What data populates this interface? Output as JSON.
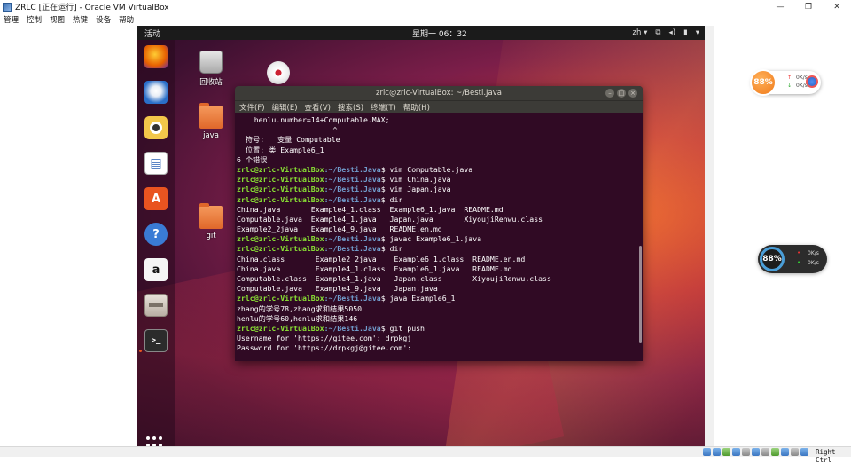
{
  "host": {
    "title": "ZRLC [正在运行] - Oracle VM VirtualBox",
    "menu": [
      "管理",
      "控制",
      "视图",
      "热键",
      "设备",
      "帮助"
    ],
    "controls": {
      "minimize": "—",
      "maximize": "❐",
      "close": "✕"
    },
    "host_key": "Right Ctrl"
  },
  "vm": {
    "top_panel": {
      "activities": "活动",
      "clock": "星期一 06：32",
      "lang": "zh ▾",
      "network_icon": "network-icon",
      "sound_icon": "sound-icon",
      "battery_icon": "battery-icon",
      "system_menu": "▾"
    },
    "desktop_icons": [
      {
        "label": "回收站",
        "icon": "trash-icon"
      },
      {
        "label": "java",
        "icon": "folder-icon"
      },
      {
        "label": "git",
        "icon": "folder-icon"
      },
      {
        "label": "",
        "icon": "cd-icon"
      }
    ],
    "dock": [
      {
        "name": "firefox",
        "glyph": "🦊",
        "color": "#e66000"
      },
      {
        "name": "thunderbird",
        "glyph": "✉",
        "color": "#2a6fc9"
      },
      {
        "name": "rhythmbox",
        "glyph": "◉",
        "color": "#f3c74a"
      },
      {
        "name": "libreoffice-writer",
        "glyph": "▤",
        "color": "#2a61b4"
      },
      {
        "name": "software-center",
        "glyph": "A",
        "color": "#e95420"
      },
      {
        "name": "help",
        "glyph": "?",
        "color": "#3a7bd5"
      },
      {
        "name": "amazon",
        "glyph": "a",
        "color": "#f5f5f5"
      },
      {
        "name": "files",
        "glyph": "▭",
        "color": "#d9d1c7"
      },
      {
        "name": "terminal",
        "glyph": ">_",
        "color": "#2b2b2b"
      }
    ]
  },
  "terminal": {
    "title": "zrlc@zrlc-VirtualBox: ~/Besti.Java",
    "menu": [
      "文件(F)",
      "编辑(E)",
      "查看(V)",
      "搜索(S)",
      "终端(T)",
      "帮助(H)"
    ],
    "buttons": {
      "minimize": "–",
      "maximize": "□",
      "close": "×"
    },
    "prompt_user": "zrlc@zrlc-VirtualBox",
    "prompt_path": ":~/Besti.Java",
    "lines": [
      {
        "text": "    henlu.number=14+Computable.MAX;"
      },
      {
        "text": "                      ^"
      },
      {
        "text": "  符号:   变量 Computable"
      },
      {
        "text": "  位置: 类 Example6_1"
      },
      {
        "text": "6 个错误"
      },
      {
        "prompt": true,
        "cmd": "$ vim Computable.java"
      },
      {
        "prompt": true,
        "cmd": "$ vim China.java"
      },
      {
        "prompt": true,
        "cmd": "$ vim Japan.java"
      },
      {
        "prompt": true,
        "cmd": "$ dir"
      },
      {
        "text": "China.java       Example4_1.class  Example6_1.java  README.md"
      },
      {
        "text": "Computable.java  Example4_1.java   Japan.java       XiyoujiRenwu.class"
      },
      {
        "text": "Example2_2java   Example4_9.java   README.en.md"
      },
      {
        "prompt": true,
        "cmd": "$ javac Example6_1.java"
      },
      {
        "prompt": true,
        "cmd": "$ dir"
      },
      {
        "text": "China.class       Example2_2java    Example6_1.class  README.en.md"
      },
      {
        "text": "China.java        Example4_1.class  Example6_1.java   README.md"
      },
      {
        "text": "Computable.class  Example4_1.java   Japan.class       XiyoujiRenwu.class"
      },
      {
        "text": "Computable.java   Example4_9.java   Japan.java"
      },
      {
        "prompt": true,
        "cmd": "$ java Example6_1"
      },
      {
        "text": "zhang的学号78,zhang求和结果5050"
      },
      {
        "text": "henlu的学号60,henlu求和结果146"
      },
      {
        "prompt": true,
        "cmd": "$ git push"
      },
      {
        "text": "Username for 'https://gitee.com': drpkgj"
      },
      {
        "text": "Password for 'https://drpkgj@gitee.com':"
      }
    ]
  },
  "widgets": {
    "speed_ball_1": {
      "percent": "88%",
      "up": "0K/s",
      "down": "0K/s"
    },
    "speed_ball_2": {
      "percent": "88%",
      "up": "0K/s",
      "down": "0K/s"
    }
  },
  "colors": {
    "terminal_bg": "#300a24",
    "prompt_user": "#8ae234",
    "prompt_path": "#729fcf",
    "ubuntu_orange": "#e95420"
  }
}
